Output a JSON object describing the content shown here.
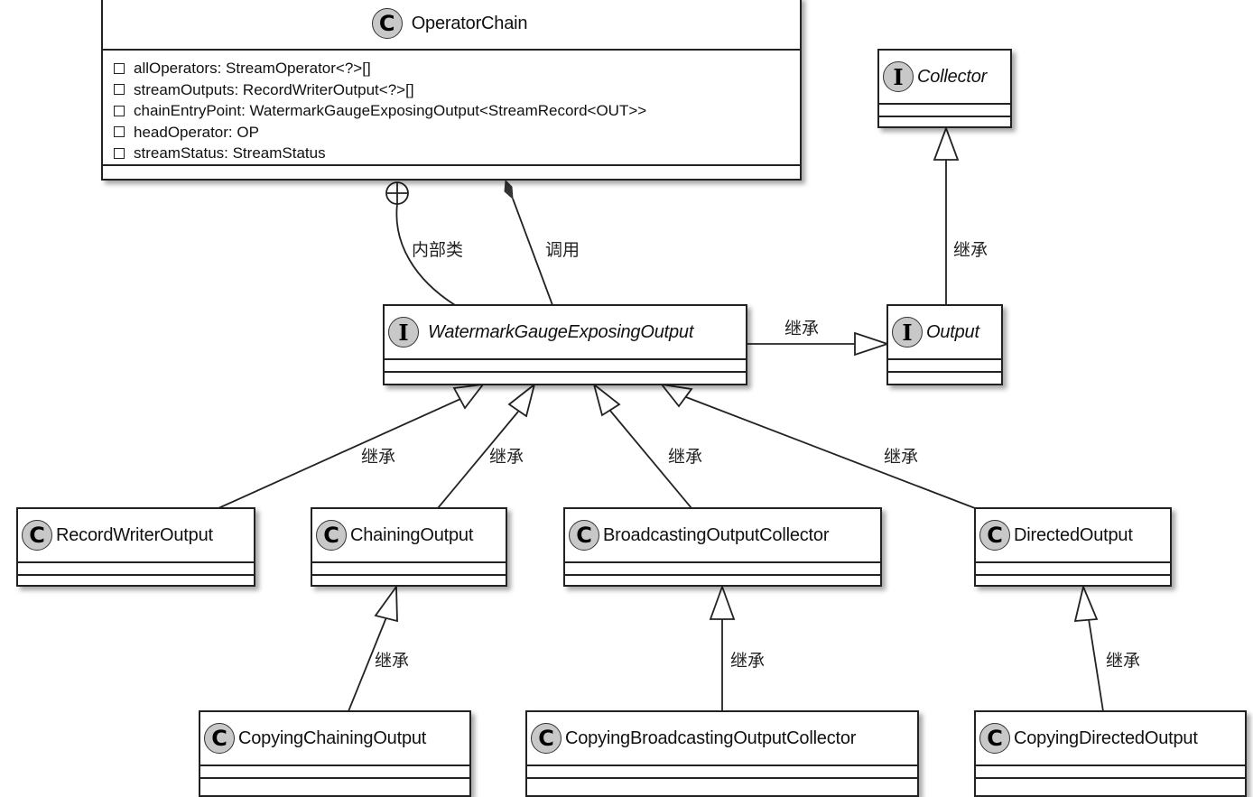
{
  "diagram": {
    "type": "uml-class-diagram",
    "classes": {
      "operator_chain": {
        "kind": "class",
        "badge": "C",
        "name": "OperatorChain",
        "attributes": [
          "allOperators: StreamOperator<?>[]",
          "streamOutputs: RecordWriterOutput<?>[]",
          "chainEntryPoint: WatermarkGaugeExposingOutput<StreamRecord<OUT>>",
          "headOperator: OP",
          "streamStatus: StreamStatus"
        ]
      },
      "collector": {
        "kind": "interface",
        "badge": "I",
        "name": "Collector"
      },
      "watermark_gauge": {
        "kind": "interface",
        "badge": "I",
        "name": "WatermarkGaugeExposingOutput"
      },
      "output": {
        "kind": "interface",
        "badge": "I",
        "name": "Output"
      },
      "record_writer_output": {
        "kind": "class",
        "badge": "C",
        "name": "RecordWriterOutput"
      },
      "chaining_output": {
        "kind": "class",
        "badge": "C",
        "name": "ChainingOutput"
      },
      "broadcasting_collector": {
        "kind": "class",
        "badge": "C",
        "name": "BroadcastingOutputCollector"
      },
      "directed_output": {
        "kind": "class",
        "badge": "C",
        "name": "DirectedOutput"
      },
      "copying_chaining_output": {
        "kind": "class",
        "badge": "C",
        "name": "CopyingChainingOutput"
      },
      "copying_broadcasting_collector": {
        "kind": "class",
        "badge": "C",
        "name": "CopyingBroadcastingOutputCollector"
      },
      "copying_directed_output": {
        "kind": "class",
        "badge": "C",
        "name": "CopyingDirectedOutput"
      }
    },
    "relations": [
      {
        "from": "watermark_gauge",
        "to": "operator_chain",
        "type": "nested",
        "label": "内部类"
      },
      {
        "from": "watermark_gauge",
        "to": "operator_chain",
        "type": "composition",
        "label": "调用"
      },
      {
        "from": "output",
        "to": "collector",
        "type": "generalization",
        "label": "继承"
      },
      {
        "from": "watermark_gauge",
        "to": "output",
        "type": "generalization",
        "label": "继承"
      },
      {
        "from": "record_writer_output",
        "to": "watermark_gauge",
        "type": "generalization",
        "label": "继承"
      },
      {
        "from": "chaining_output",
        "to": "watermark_gauge",
        "type": "generalization",
        "label": "继承"
      },
      {
        "from": "broadcasting_collector",
        "to": "watermark_gauge",
        "type": "generalization",
        "label": "继承"
      },
      {
        "from": "directed_output",
        "to": "watermark_gauge",
        "type": "generalization",
        "label": "继承"
      },
      {
        "from": "copying_chaining_output",
        "to": "chaining_output",
        "type": "generalization",
        "label": "继承"
      },
      {
        "from": "copying_broadcasting_collector",
        "to": "broadcasting_collector",
        "type": "generalization",
        "label": "继承"
      },
      {
        "from": "copying_directed_output",
        "to": "directed_output",
        "type": "generalization",
        "label": "继承"
      }
    ]
  }
}
